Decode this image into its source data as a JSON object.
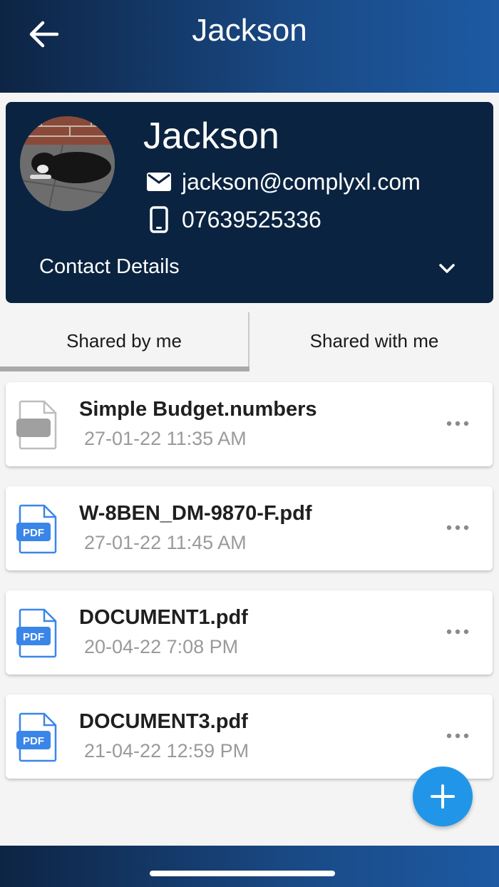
{
  "header": {
    "title": "Jackson",
    "back_icon": "arrow-left-icon"
  },
  "profile": {
    "name": "Jackson",
    "email": "jackson@complyxl.com",
    "phone": "07639525336",
    "contact_details_label": "Contact Details",
    "avatar_icon": "avatar-photo",
    "email_icon": "envelope-icon",
    "phone_icon": "mobile-phone-icon",
    "expand_icon": "chevron-down-icon"
  },
  "tabs": [
    {
      "label": "Shared by me",
      "selected": true
    },
    {
      "label": "Shared with me",
      "selected": false
    }
  ],
  "files": [
    {
      "name": "Simple Budget.numbers",
      "date": "27-01-22 11:35 AM",
      "icon": "numbers-file-icon"
    },
    {
      "name": "W-8BEN_DM-9870-F.pdf",
      "date": "27-01-22 11:45 AM",
      "icon": "pdf-file-icon"
    },
    {
      "name": "DOCUMENT1.pdf",
      "date": "20-04-22 7:08 PM",
      "icon": "pdf-file-icon"
    },
    {
      "name": "DOCUMENT3.pdf",
      "date": "21-04-22 12:59 PM",
      "icon": "pdf-file-icon"
    }
  ],
  "pdf_badge_text": "PDF",
  "fab_icon": "plus-icon",
  "colors": {
    "header_gradient_start": "#0d2444",
    "header_gradient_end": "#1d5aa3",
    "profile_card": "#0a2340",
    "fab": "#2196e8",
    "pdf_blue": "#3a86e8"
  }
}
